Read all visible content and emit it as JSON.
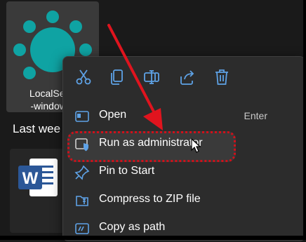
{
  "desktop": {
    "app_tile": {
      "name_line1": "LocalSend",
      "name_line2": "-windows-"
    },
    "section_heading": "Last wee",
    "doc_tile": {
      "name": ""
    }
  },
  "context_menu": {
    "quick_actions": [
      {
        "icon": "cut-icon"
      },
      {
        "icon": "copy-icon"
      },
      {
        "icon": "rename-icon"
      },
      {
        "icon": "share-icon"
      },
      {
        "icon": "delete-icon"
      }
    ],
    "items": [
      {
        "label": "Open",
        "shortcut": "Enter",
        "icon": "open-icon"
      },
      {
        "label": "Run as administrator",
        "icon": "shield-window-icon",
        "highlighted": true
      },
      {
        "label": "Pin to Start",
        "icon": "pin-icon"
      },
      {
        "label": "Compress to ZIP file",
        "icon": "zip-icon"
      },
      {
        "label": "Copy as path",
        "icon": "copy-path-icon"
      }
    ]
  },
  "colors": {
    "accent_blue": "#5ea2e6",
    "annotation_red": "#e0141e",
    "app_teal": "#0fa3a3",
    "word_blue": "#2b5797"
  }
}
